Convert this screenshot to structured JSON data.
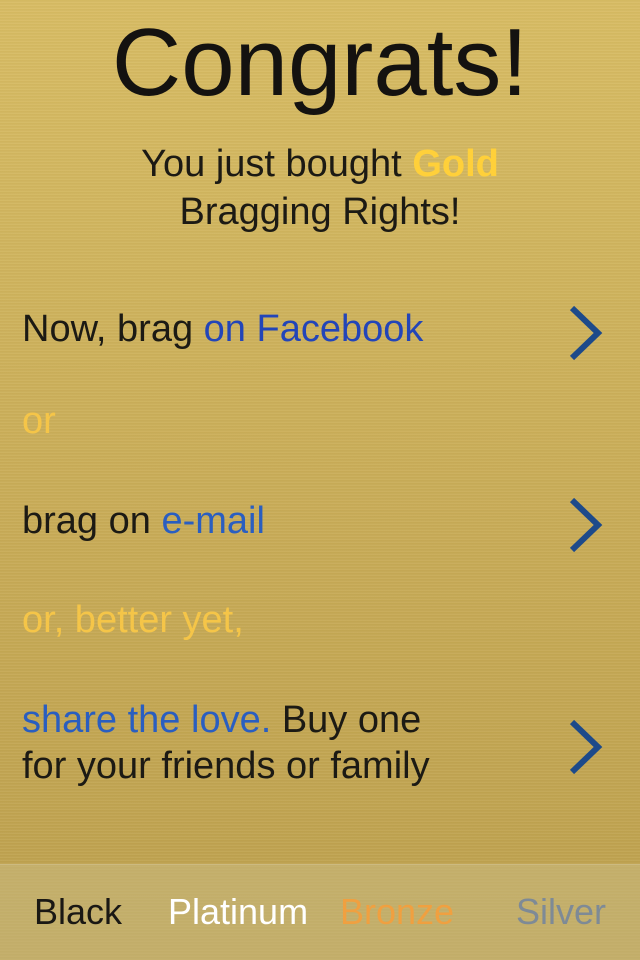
{
  "header": {
    "title": "Congrats!",
    "subtitle_pre": "You just bought ",
    "subtitle_tier": "Gold",
    "subtitle_post": "Bragging Rights!"
  },
  "actions": {
    "facebook": {
      "prefix": "Now, brag ",
      "link": "on Facebook"
    },
    "or_1": "or",
    "email": {
      "prefix": "brag on ",
      "link": "e-mail"
    },
    "or_2": "or, better yet,",
    "share": {
      "link": "share the love.",
      "line1_rest": " Buy one",
      "line2": "for your friends or family"
    }
  },
  "tabs": [
    {
      "label": "Black"
    },
    {
      "label": "Platinum"
    },
    {
      "label": "Bronze"
    },
    {
      "label": "Silver"
    }
  ],
  "icons": {
    "chevron": "chevron-right-icon"
  },
  "colors": {
    "background": "#c9ac55",
    "tier_highlight": "#ffd03a",
    "link": "#2a5ec0",
    "or_text": "#f5c548",
    "chevron": "#1d4a8a",
    "tab_black": "#1a1814",
    "tab_platinum": "#ffffff",
    "tab_bronze": "#f0a040",
    "tab_silver": "#7e8a96"
  }
}
